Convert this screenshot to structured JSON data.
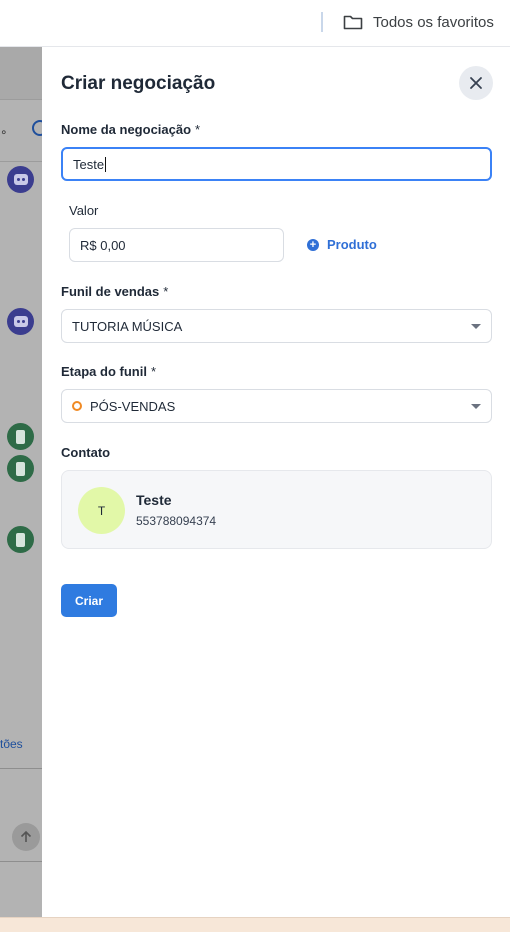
{
  "topbar": {
    "favorites_label": "Todos os favoritos",
    "folder_icon": "folder-icon"
  },
  "background": {
    "actions_partial": "tões"
  },
  "modal": {
    "title": "Criar negociação",
    "close_icon": "close-icon",
    "deal_name": {
      "label": "Nome da negociação",
      "required": "*",
      "value": "Teste"
    },
    "value": {
      "label": "Valor",
      "value": "R$ 0,00"
    },
    "product_button": {
      "label": "Produto",
      "icon": "plus-circle-icon"
    },
    "sales_funnel": {
      "label": "Funil de vendas",
      "required": "*",
      "selected": "TUTORIA MÚSICA"
    },
    "funnel_stage": {
      "label": "Etapa do funil",
      "required": "*",
      "selected": "PÓS-VENDAS",
      "stage_color": "#f08a24"
    },
    "contact": {
      "label": "Contato",
      "avatar_initial": "T",
      "name": "Teste",
      "phone": "553788094374"
    },
    "create_button": "Criar"
  },
  "colors": {
    "accent": "#2f7be0",
    "focus_border": "#3b82f6",
    "avatar_bg": "#e2f8a8",
    "overlay": "#b3b3b3"
  }
}
